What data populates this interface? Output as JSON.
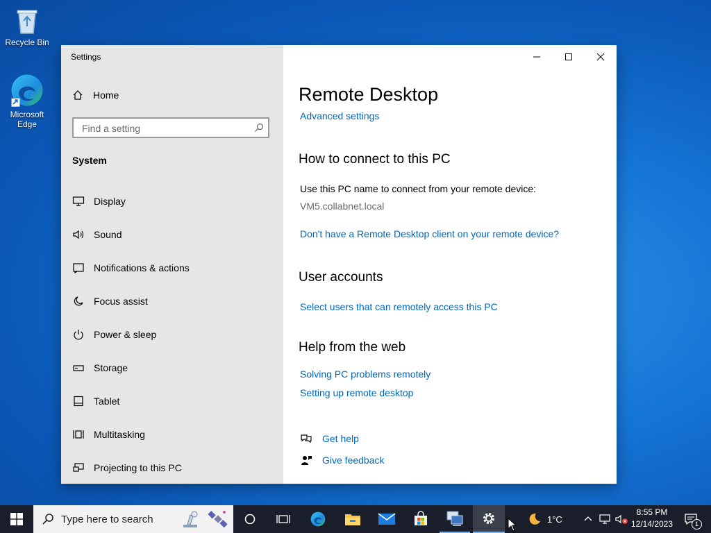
{
  "desktop": {
    "icons": [
      {
        "label": "Recycle Bin",
        "icon": "recycle-bin-icon"
      },
      {
        "label": "Microsoft Edge",
        "icon": "edge-icon"
      }
    ]
  },
  "window": {
    "title": "Settings",
    "controls": {
      "minimize": "minimize-icon",
      "maximize": "maximize-icon",
      "close": "close-icon"
    }
  },
  "sidebar": {
    "home_label": "Home",
    "search_placeholder": "Find a setting",
    "section_label": "System",
    "items": [
      {
        "label": "Display",
        "icon": "monitor-icon"
      },
      {
        "label": "Sound",
        "icon": "speaker-icon"
      },
      {
        "label": "Notifications & actions",
        "icon": "notification-icon"
      },
      {
        "label": "Focus assist",
        "icon": "moon-icon"
      },
      {
        "label": "Power & sleep",
        "icon": "power-icon"
      },
      {
        "label": "Storage",
        "icon": "storage-icon"
      },
      {
        "label": "Tablet",
        "icon": "tablet-icon"
      },
      {
        "label": "Multitasking",
        "icon": "multitasking-icon"
      },
      {
        "label": "Projecting to this PC",
        "icon": "projecting-icon"
      }
    ]
  },
  "main": {
    "title": "Remote Desktop",
    "advanced_link": "Advanced settings",
    "connect_heading": "How to connect to this PC",
    "connect_text": "Use this PC name to connect from your remote device:",
    "pc_name": "VM5.collabnet.local",
    "client_link": "Don't have a Remote Desktop client on your remote device?",
    "accounts_heading": "User accounts",
    "accounts_link": "Select users that can remotely access this PC",
    "web_heading": "Help from the web",
    "web_links": [
      "Solving PC problems remotely",
      "Setting up remote desktop"
    ],
    "get_help": "Get help",
    "give_feedback": "Give feedback"
  },
  "taskbar": {
    "search_placeholder": "Type here to search",
    "weather": "1°C",
    "time": "8:55 PM",
    "date": "12/14/2023",
    "notification_count": "1"
  },
  "colors": {
    "link": "#0067b8",
    "sidebar_bg": "#e6e6e6",
    "taskbar_bg": "#1a1e2a"
  }
}
